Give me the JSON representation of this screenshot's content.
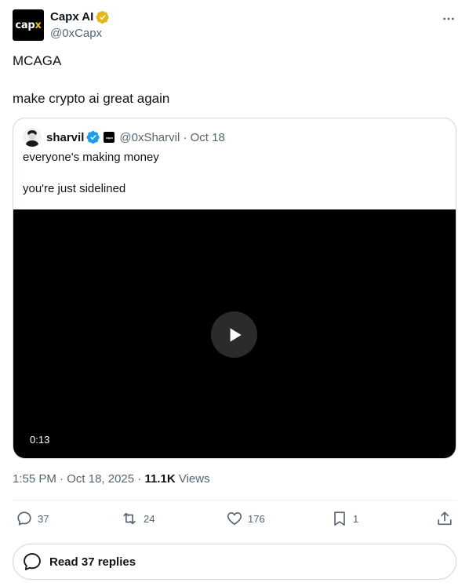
{
  "author": {
    "name": "Capx AI",
    "handle": "@0xCapx",
    "avatar_text": "cap",
    "avatar_text_accent": "x",
    "verified_badge_color": "#e2b719"
  },
  "tweet": {
    "text": "MCAGA\n\nmake crypto ai great again"
  },
  "quote": {
    "name": "sharvil",
    "handle": "@0xSharvil",
    "date": "Oct 18",
    "affiliate_badge_text": "capx",
    "verified_badge_color": "#1d9bf0",
    "text": "everyone's making money\n\nyou're just sidelined",
    "video": {
      "duration": "0:13"
    }
  },
  "timestamp": {
    "time": "1:55 PM",
    "date": "Oct 18, 2025",
    "views_count": "11.1K",
    "views_label": "Views"
  },
  "actions": {
    "replies": "37",
    "reposts": "24",
    "likes": "176",
    "bookmarks": "1"
  },
  "read_replies_label": "Read 37 replies",
  "colors": {
    "secondary_text": "#536471",
    "border": "#cfd9de"
  }
}
